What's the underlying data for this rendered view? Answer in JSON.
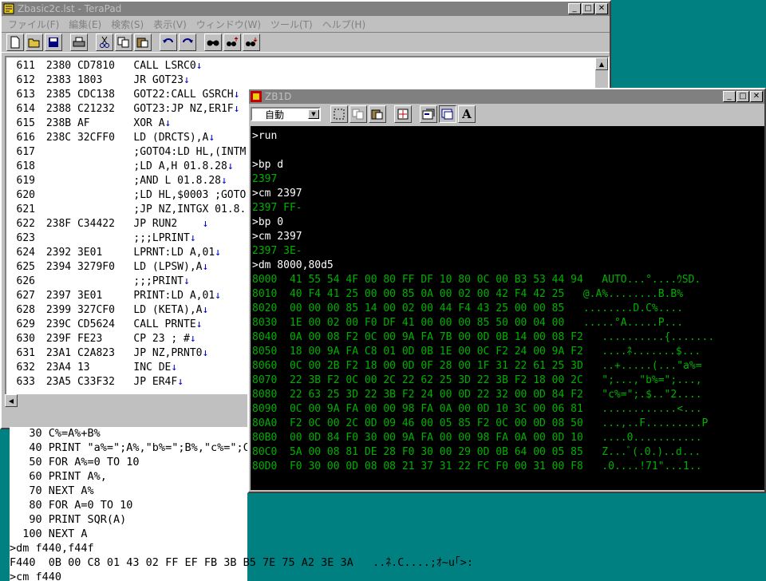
{
  "teraPad": {
    "title": "Zbasic2c.lst - TeraPad",
    "menu": [
      "ファイル(F)",
      "編集(E)",
      "検索(S)",
      "表示(V)",
      "ウィンドウ(W)",
      "ツール(T)",
      "ヘルプ(H)"
    ],
    "toolbar_icons": [
      "new-file-icon",
      "open-folder-icon",
      "save-icon",
      "print-icon",
      "cut-icon",
      "copy-icon",
      "paste-icon",
      "undo-icon",
      "redo-icon",
      "find-icon",
      "find-next-icon",
      "find-prev-icon"
    ],
    "lines": [
      {
        "num": "611",
        "text": " 2380 CD7810   CALL LSRC0",
        "lf": true
      },
      {
        "num": "612",
        "text": " 2383 1803     JR GOT23",
        "lf": true
      },
      {
        "num": "613",
        "text": " 2385 CDC138   GOT22:CALL GSRCH",
        "lf": true
      },
      {
        "num": "614",
        "text": " 2388 C21232   GOT23:JP NZ,ER1F",
        "lf": true
      },
      {
        "num": "615",
        "text": " 238B AF       XOR A",
        "lf": true
      },
      {
        "num": "616",
        "text": " 238C 32CFF0   LD (DRCTS),A",
        "lf": true
      },
      {
        "num": "617",
        "text": "               ;GOTO4:LD HL,(INTM",
        "lf": false
      },
      {
        "num": "618",
        "text": "               ;LD A,H 01.8.28",
        "lf": true
      },
      {
        "num": "619",
        "text": "               ;AND L 01.8.28",
        "lf": true
      },
      {
        "num": "620",
        "text": "               ;LD HL,$0003 ;GOTO",
        "lf": false
      },
      {
        "num": "621",
        "text": "               ;JP NZ,INTGX 01.8.",
        "lf": false
      },
      {
        "num": "622",
        "text": " 238F C34422   JP RUN2    ",
        "lf": true
      },
      {
        "num": "623",
        "text": "               ;;;LPRINT",
        "lf": true
      },
      {
        "num": "624",
        "text": " 2392 3E01     LPRNT:LD A,01",
        "lf": true
      },
      {
        "num": "625",
        "text": " 2394 3279F0   LD (LPSW),A",
        "lf": true
      },
      {
        "num": "626",
        "text": "               ;;;PRINT",
        "lf": true
      },
      {
        "num": "627",
        "text": " 2397 3E01     PRINT:LD A,01",
        "lf": true
      },
      {
        "num": "628",
        "text": " 2399 327CF0   LD (KETA),A",
        "lf": true
      },
      {
        "num": "629",
        "text": " 239C CD5624   CALL PRNTE",
        "lf": true
      },
      {
        "num": "630",
        "text": " 239F FE23     CP 23 ; #",
        "lf": true
      },
      {
        "num": "631",
        "text": " 23A1 C2A823   JP NZ,PRNT0",
        "lf": true
      },
      {
        "num": "632",
        "text": " 23A4 13       INC DE",
        "lf": true
      },
      {
        "num": "633",
        "text": " 23A5 C33F32   JP ER4F",
        "lf": true
      }
    ],
    "lf_mark": "↓"
  },
  "zb1d": {
    "title": "ZB1D",
    "font_select": "自動",
    "toolbar_icons": [
      "mark-icon",
      "copy-icon",
      "paste-icon",
      "fullscreen-icon",
      "properties-icon",
      "background-icon",
      "font-icon"
    ],
    "font_button": "A",
    "lines": [
      {
        "text": ">run",
        "green": false
      },
      {
        "text": "",
        "green": false
      },
      {
        "text": ">bp d",
        "green": false
      },
      {
        "text": "2397",
        "green": true
      },
      {
        "text": ">cm 2397",
        "green": false
      },
      {
        "text": "2397 FF-",
        "green": true
      },
      {
        "text": ">bp 0",
        "green": false
      },
      {
        "text": ">cm 2397",
        "green": false
      },
      {
        "text": "2397 3E-",
        "green": true
      },
      {
        "text": ">dm 8000,80d5",
        "green": false
      },
      {
        "text": "8000  41 55 54 4F 00 80 FF DF 10 80 0C 00 B3 53 44 94   AUTO...°....ｳSD.",
        "green": true
      },
      {
        "text": "8010  40 F4 41 25 00 00 85 0A 00 02 00 42 F4 42 25   @.A%........B.B%",
        "green": true
      },
      {
        "text": "8020  00 00 00 85 14 00 02 00 44 F4 43 25 00 00 85   ........D.C%....",
        "green": true
      },
      {
        "text": "8030  1E 00 02 00 F0 DF 41 00 00 00 85 50 00 04 00   .....°A.....P...",
        "green": true
      },
      {
        "text": "8040  0A 00 08 F2 0C 00 9A FA 7B 00 0D 0B 14 00 08 F2   ..........{.......",
        "green": true
      },
      {
        "text": "8050  18 00 9A FA C8 01 0D 0B 1E 00 0C F2 24 00 9A F2   ....ﾈ.......$...",
        "green": true
      },
      {
        "text": "8060  0C 00 2B F2 18 00 0D 0F 28 00 1F 31 22 61 25 3D   ..+.....(...\"a%=",
        "green": true
      },
      {
        "text": "8070  22 3B F2 0C 00 2C 22 62 25 3D 22 3B F2 18 00 2C   \";...,\"b%=\";...,",
        "green": true
      },
      {
        "text": "8080  22 63 25 3D 22 3B F2 24 00 0D 22 32 00 0D 84 F2   \"c%=\";.$..\"2....",
        "green": true
      },
      {
        "text": "8090  0C 00 9A FA 00 00 98 FA 0A 00 0D 10 3C 00 06 81   ............<...",
        "green": true
      },
      {
        "text": "80A0  F2 0C 00 2C 0D 09 46 00 05 85 F2 0C 00 0D 08 50   ...,..F.........P",
        "green": true
      },
      {
        "text": "80B0  00 0D 84 F0 30 00 9A FA 00 00 98 FA 0A 00 0D 10   ....0...........",
        "green": true
      },
      {
        "text": "80C0  5A 00 08 81 DE 28 F0 30 00 29 0D 0B 64 00 05 85   Z...ﾞ(.0.)..d...",
        "green": true
      },
      {
        "text": "80D0  F0 30 00 0D 08 08 21 37 31 22 FC F0 00 31 00 F8   .0....!71\"...1..",
        "green": true
      }
    ]
  },
  "basic": {
    "lines": [
      "   30 C%=A%+B%",
      "   40 PRINT \"a%=\";A%,\"b%=\";B%,\"c%=\";C%",
      "   50 FOR A%=0 TO 10",
      "   60 PRINT A%,",
      "   70 NEXT A%",
      "   80 FOR A=0 TO 10",
      "   90 PRINT SQR(A)",
      "  100 NEXT A",
      ">dm f440,f44f",
      "F440  0B 00 C8 01 43 02 FF EF FB 3B B5 7E 75 A2 3E 3A   ..ﾈ.C....;ｵ~u｢>:",
      ">cm f440"
    ]
  }
}
